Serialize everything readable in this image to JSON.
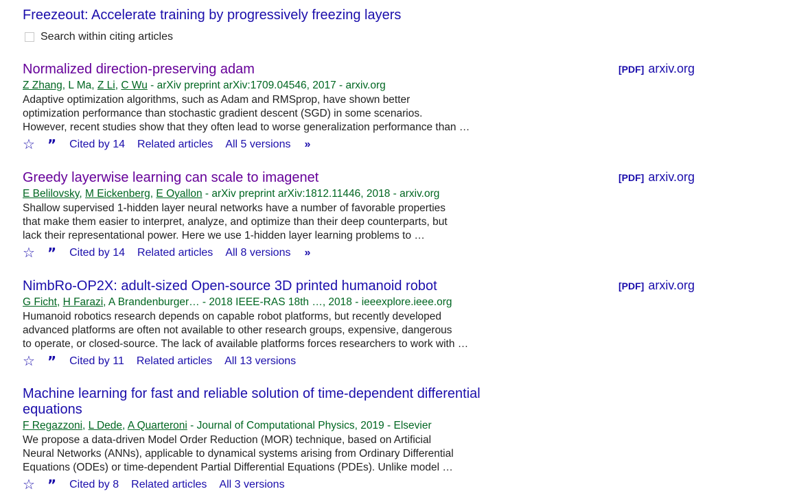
{
  "header": {
    "title": "Freezeout: Accelerate training by progressively freezing layers",
    "search_within_label": "Search within citing articles"
  },
  "results": [
    {
      "title": "Normalized direction-preserving adam",
      "authors": [
        "Z Zhang",
        "L Ma",
        "Z Li",
        "C Wu"
      ],
      "authors_linked": [
        true,
        false,
        true,
        true
      ],
      "source": " - arXiv preprint arXiv:1709.04546, 2017 - arxiv.org",
      "snippet": [
        "Adaptive optimization algorithms, such as Adam and RMSprop, have shown better",
        "optimization performance than stochastic gradient descent (SGD) in some scenarios.",
        "However, recent studies show that they often lead to worse generalization performance than …"
      ],
      "cited_by": "Cited by 14",
      "related": "Related articles",
      "versions": "All 5 versions",
      "pdf_tag": "[PDF]",
      "pdf_source": "arxiv.org"
    },
    {
      "title": "Greedy layerwise learning can scale to imagenet",
      "authors": [
        "E Belilovsky",
        "M Eickenberg",
        "E Oyallon"
      ],
      "authors_linked": [
        true,
        true,
        true
      ],
      "source": " - arXiv preprint arXiv:1812.11446, 2018 - arxiv.org",
      "snippet": [
        "Shallow supervised 1-hidden layer neural networks have a number of favorable properties",
        "that make them easier to interpret, analyze, and optimize than their deep counterparts, but",
        "lack their representational power. Here we use 1-hidden layer learning problems to …"
      ],
      "cited_by": "Cited by 14",
      "related": "Related articles",
      "versions": "All 8 versions",
      "pdf_tag": "[PDF]",
      "pdf_source": "arxiv.org"
    },
    {
      "title": "NimbRo-OP2X: adult-sized Open-source 3D printed humanoid robot",
      "authors": [
        "G Ficht",
        "H Farazi",
        "A Brandenburger…"
      ],
      "authors_linked": [
        true,
        true,
        false
      ],
      "source": " - 2018 IEEE-RAS 18th …, 2018 - ieeexplore.ieee.org",
      "snippet": [
        "Humanoid robotics research depends on capable robot platforms, but recently developed",
        "advanced platforms are often not available to other research groups, expensive, dangerous",
        "to operate, or closed-source. The lack of available platforms forces researchers to work with …"
      ],
      "cited_by": "Cited by 11",
      "related": "Related articles",
      "versions": "All 13 versions",
      "pdf_tag": "[PDF]",
      "pdf_source": "arxiv.org"
    },
    {
      "title": "Machine learning for fast and reliable solution of time-dependent differential equations",
      "authors": [
        "F Regazzoni",
        "L Dede",
        "A Quarteroni"
      ],
      "authors_linked": [
        true,
        true,
        true
      ],
      "source": " - Journal of Computational Physics, 2019 - Elsevier",
      "snippet": [
        "We propose a data-driven Model Order Reduction (MOR) technique, based on Artificial",
        "Neural Networks (ANNs), applicable to dynamical systems arising from Ordinary Differential",
        "Equations (ODEs) or time-dependent Partial Differential Equations (PDEs). Unlike model …"
      ],
      "cited_by": "Cited by 8",
      "related": "Related articles",
      "versions": "All 3 versions"
    }
  ],
  "icons": {
    "save": "star-icon",
    "cite": "quote-icon",
    "more": "double-chevron-right-icon"
  },
  "colors": {
    "title_visited": "#660099",
    "title_link": "#1a0dab",
    "authors_green": "#006621",
    "link_blue": "#1a0dab"
  }
}
